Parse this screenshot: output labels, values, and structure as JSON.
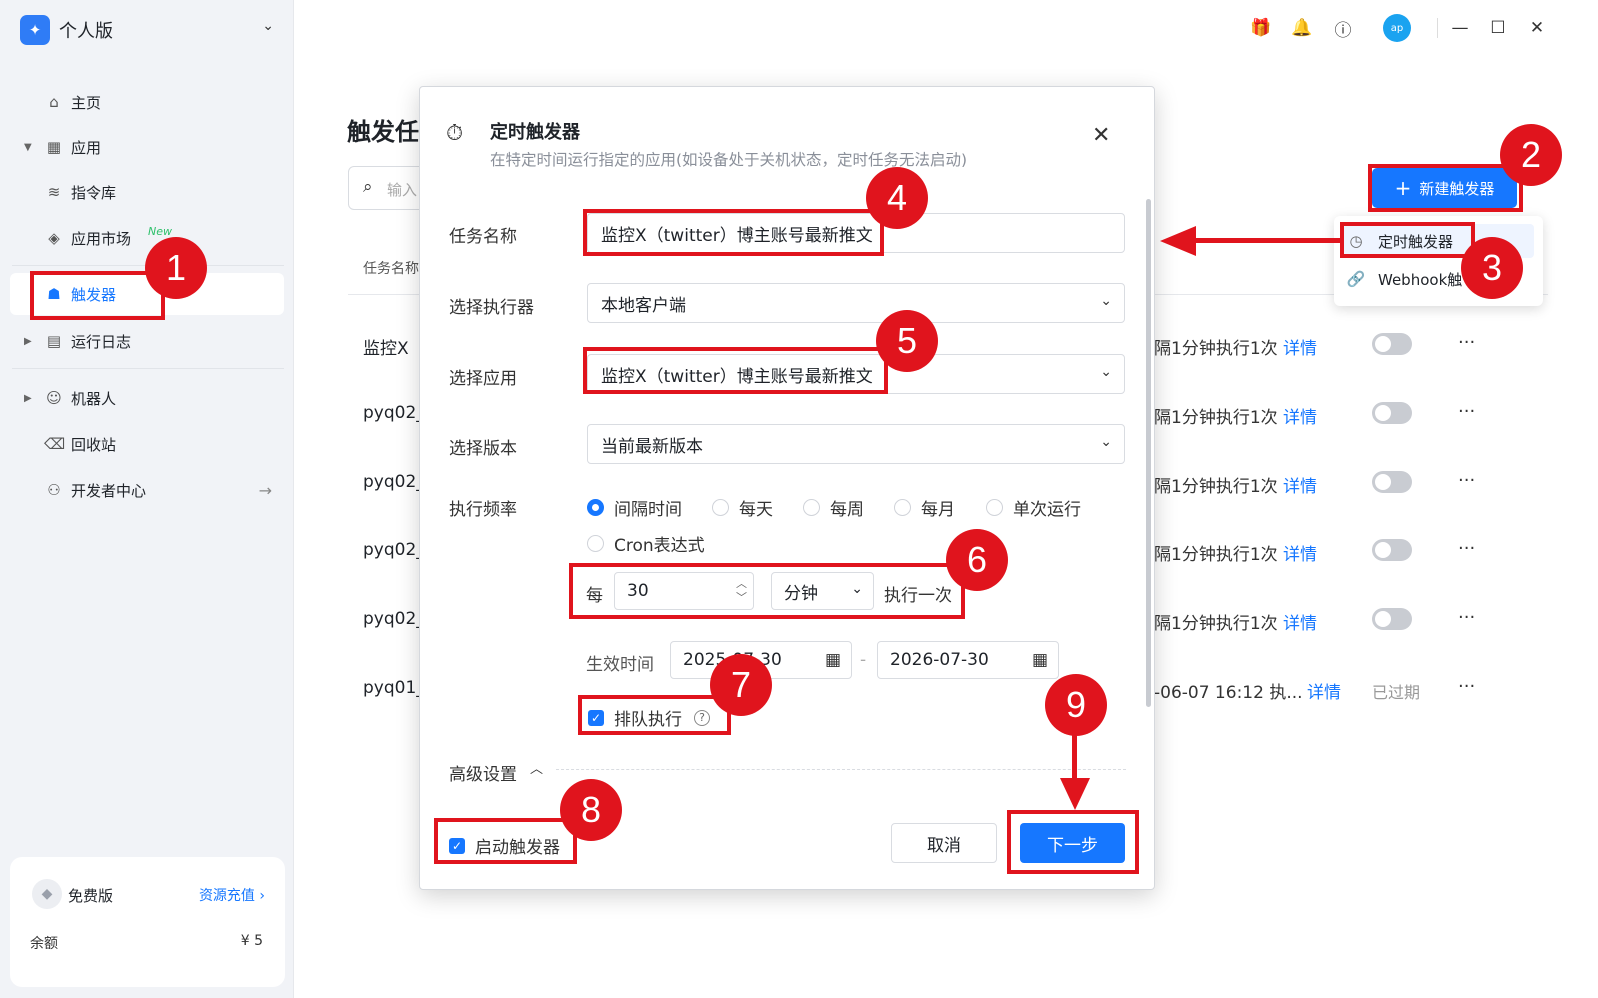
{
  "sidebar": {
    "brand": "个人版",
    "nav": [
      {
        "label": "主页",
        "icon": "home-icon"
      },
      {
        "label": "应用",
        "icon": "apps-icon"
      },
      {
        "label": "指令库",
        "icon": "layers-icon"
      },
      {
        "label": "应用市场",
        "icon": "market-icon",
        "badge": "New"
      },
      {
        "label": "触发器",
        "icon": "trigger-icon"
      },
      {
        "label": "运行日志",
        "icon": "log-icon"
      },
      {
        "label": "机器人",
        "icon": "robot-icon"
      },
      {
        "label": "回收站",
        "icon": "trash-icon"
      },
      {
        "label": "开发者中心",
        "icon": "developer-icon"
      }
    ],
    "plan": {
      "name": "免费版",
      "recharge": "资源充值 ›",
      "balance_label": "余额",
      "balance_value": "¥ 5"
    }
  },
  "topbar": {
    "avatar": "ap"
  },
  "main": {
    "title": "触发任",
    "search_placeholder": "输入",
    "column_task_name": "任务名称",
    "new_trigger_label": "新建触发器",
    "menu": [
      {
        "label": "定时触发器",
        "icon": "clock-icon"
      },
      {
        "label": "Webhook触",
        "icon": "link-icon"
      }
    ],
    "rows": [
      {
        "name": "监控X",
        "freq": "隔1分钟执行1次",
        "detail": "详情",
        "status": ""
      },
      {
        "name": "pyq02_",
        "freq": "隔1分钟执行1次",
        "detail": "详情",
        "status": ""
      },
      {
        "name": "pyq02_",
        "freq": "隔1分钟执行1次",
        "detail": "详情",
        "status": ""
      },
      {
        "name": "pyq02_",
        "freq": "隔1分钟执行1次",
        "detail": "详情",
        "status": ""
      },
      {
        "name": "pyq02_",
        "freq": "隔1分钟执行1次",
        "detail": "详情",
        "status": ""
      },
      {
        "name": "pyq01_",
        "freq": "-06-07 16:12 执...",
        "detail": "详情",
        "status": "已过期"
      }
    ]
  },
  "modal": {
    "title": "定时触发器",
    "subtitle": "在特定时间运行指定的应用(如设备处于关机状态，定时任务无法启动)",
    "fields": {
      "task_name_label": "任务名称",
      "task_name_value": "监控X（twitter）博主账号最新推文",
      "executor_label": "选择执行器",
      "executor_value": "本地客户端",
      "app_label": "选择应用",
      "app_value": "监控X（twitter）博主账号最新推文",
      "version_label": "选择版本",
      "version_value": "当前最新版本",
      "frequency_label": "执行频率"
    },
    "frequency_options": [
      "间隔时间",
      "每天",
      "每周",
      "每月",
      "单次运行",
      "Cron表达式"
    ],
    "interval": {
      "prefix": "每",
      "value": "30",
      "unit": "分钟",
      "suffix": "执行一次"
    },
    "effective": {
      "label": "生效时间",
      "start": "2025-07-30",
      "end": "2026-07-30",
      "separator": "-"
    },
    "queue_label": "排队执行",
    "advanced_label": "高级设置",
    "enable_label": "启动触发器",
    "cancel_label": "取消",
    "next_label": "下一步"
  },
  "annotations": [
    "1",
    "2",
    "3",
    "4",
    "5",
    "6",
    "7",
    "8",
    "9"
  ],
  "colors": {
    "accent": "#1677ff",
    "annotation": "#e0141d"
  }
}
